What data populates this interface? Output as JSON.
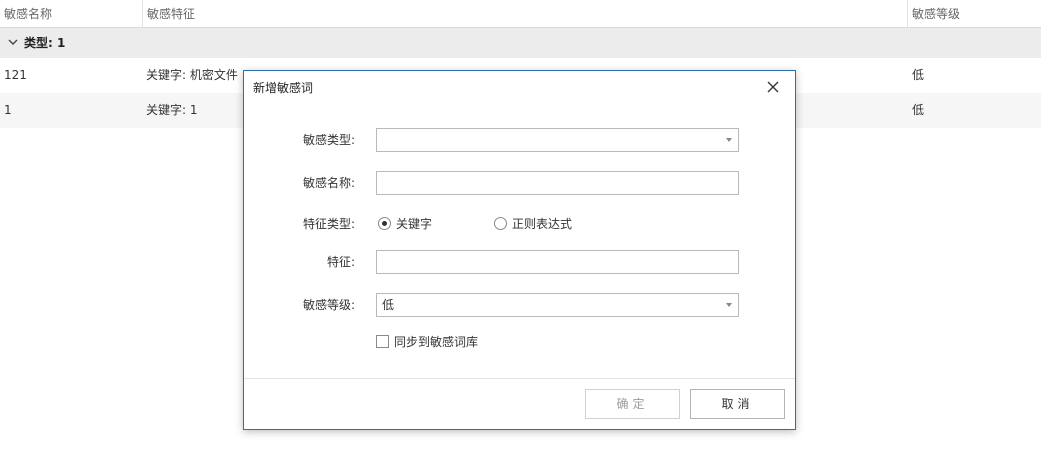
{
  "table": {
    "headers": [
      "敏感名称",
      "敏感特征",
      "敏感等级"
    ],
    "group_label": "类型: 1",
    "rows": [
      {
        "name": "121",
        "feature": "关键字: 机密文件",
        "level": "低"
      },
      {
        "name": "1",
        "feature": "关键字: 1",
        "level": "低"
      }
    ]
  },
  "dialog": {
    "title": "新增敏感词",
    "labels": {
      "type": "敏感类型:",
      "name": "敏感名称:",
      "feature_type": "特征类型:",
      "feature": "特征:",
      "level": "敏感等级:"
    },
    "type_value": "",
    "name_value": "",
    "feature_value": "",
    "level_value": "低",
    "radio_options": [
      {
        "label": "关键字",
        "selected": true
      },
      {
        "label": "正则表达式",
        "selected": false
      }
    ],
    "sync_checkbox": {
      "label": "同步到敏感词库",
      "checked": false
    },
    "ok_label": "确定",
    "cancel_label": "取消"
  },
  "colors": {
    "dialog_border": "#2b6cb3",
    "group_row_bg": "#ececec",
    "disabled_text": "#9c9c9c"
  },
  "icons": [
    "chevron-down-icon",
    "close-icon",
    "dropdown-caret-icon"
  ]
}
